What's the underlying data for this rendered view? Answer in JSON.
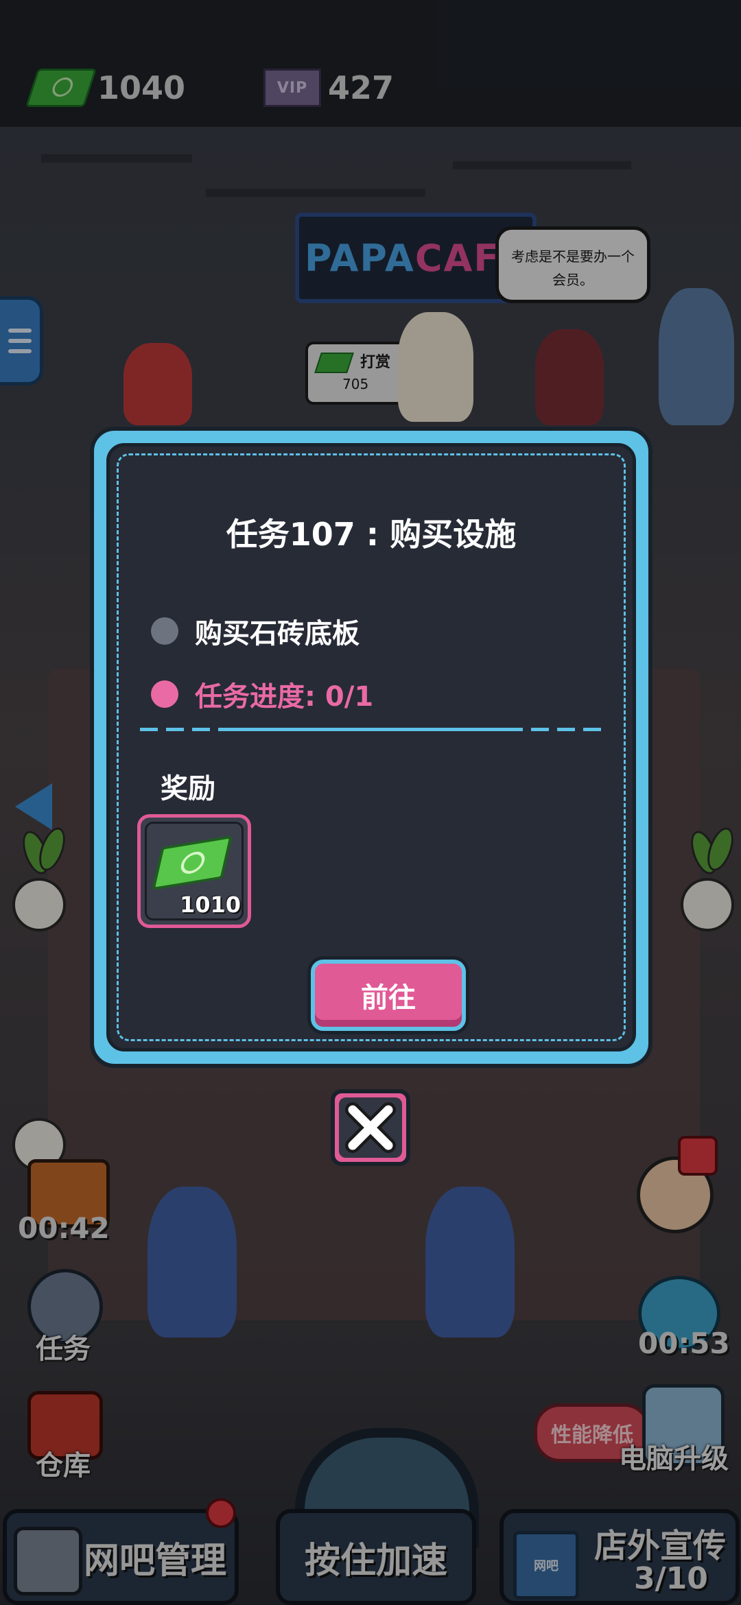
{
  "header": {
    "cash_value": "1040",
    "vip_value": "427",
    "vip_icon_text": "VIP"
  },
  "scene": {
    "sign_text_a": "PAPA",
    "sign_text_b": "CAFE",
    "speech_line1": "考虑是不是要办一个",
    "speech_line2": "会员。",
    "tip_label": "打赏",
    "tip_value": "705"
  },
  "hud": {
    "delivery_timer": "00:42",
    "tasks_label": "任务",
    "warehouse_label": "仓库",
    "upgrade_timer": "00:53",
    "perf_badge": "性能降低",
    "pc_upgrade_label": "电脑升级",
    "manage_label": "网吧管理",
    "speedup_label": "按住加速",
    "promo_label": "店外宣传",
    "promo_count": "3/10",
    "promo_sign": "网吧"
  },
  "dialog": {
    "title": "任务107 : 购买设施",
    "task_item": "购买石砖底板",
    "progress": "任务进度: 0/1",
    "reward_label": "奖励",
    "reward_amount": "1010",
    "go_button": "前往"
  },
  "colors": {
    "dialog_frame": "#5ec1e6",
    "accent_pink": "#e05a96",
    "panel_bg": "#272b36",
    "progress_text": "#e96aa5",
    "bullet_grey": "#6e7380"
  }
}
